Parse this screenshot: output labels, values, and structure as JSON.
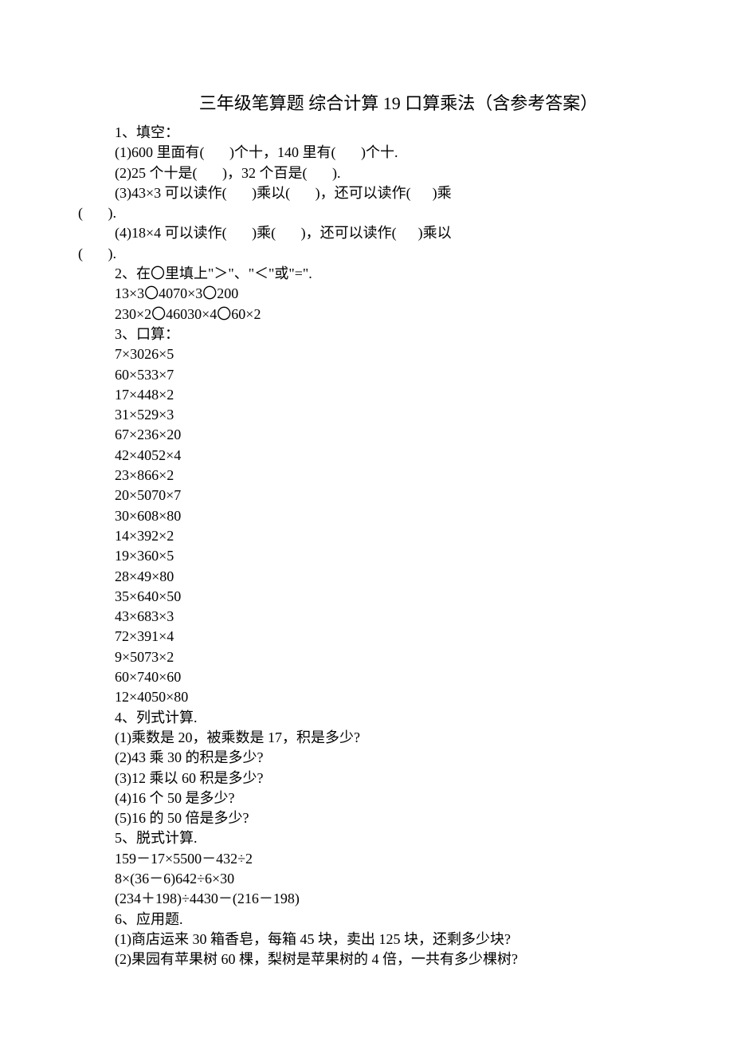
{
  "title": "三年级笔算题 综合计算 19   口算乘法（含参考答案）",
  "q1": {
    "heading": "1、填空：",
    "items": [
      "(1)600 里面有(       )个十，140 里有(       )个十.",
      "(2)25 个十是(       )，32 个百是(       ).",
      "(3)43×3 可以读作(       )乘以(       )，还可以读作(      )乘",
      "(       ).",
      "(4)18×4 可以读作(       )乘(       )，还可以读作(      )乘以",
      "(       )."
    ]
  },
  "q2": {
    "heading": "2、在〇里填上\"＞\"、\"＜\"或\"=\".",
    "lines": [
      "13×3〇4070×3〇200",
      "230×2〇46030×4〇60×2"
    ]
  },
  "q3": {
    "heading": "3、口算：",
    "lines": [
      "7×3026×5",
      "60×533×7",
      "17×448×2",
      "31×529×3",
      "67×236×20",
      "42×4052×4",
      "23×866×2",
      "20×5070×7",
      "30×608×80",
      "14×392×2",
      "19×360×5",
      "28×49×80",
      "35×640×50",
      "43×683×3",
      "72×391×4",
      "9×5073×2",
      "60×740×60",
      "12×4050×80"
    ]
  },
  "q4": {
    "heading": "4、列式计算.",
    "lines": [
      "(1)乘数是 20，被乘数是 17，积是多少?",
      "(2)43 乘 30 的积是多少?",
      "(3)12 乘以 60 积是多少?",
      "(4)16 个 50 是多少?",
      "(5)16 的 50 倍是多少?"
    ]
  },
  "q5": {
    "heading": "5、脱式计算.",
    "lines": [
      "159－17×5500－432÷2",
      "8×(36－6)642÷6×30",
      "(234＋198)÷4430－(216－198)"
    ]
  },
  "q6": {
    "heading": "6、应用题.",
    "lines": [
      "(1)商店运来 30 箱香皂，每箱 45 块，卖出 125 块，还剩多少块?",
      "(2)果园有苹果树 60 棵，梨树是苹果树的 4 倍，一共有多少棵树?"
    ]
  }
}
